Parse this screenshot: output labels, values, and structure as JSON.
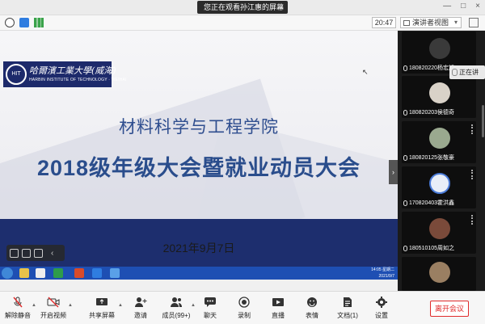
{
  "top_bar": {
    "share_notice": "您正在观看孙江惠的屏幕",
    "close": "×"
  },
  "window_controls": [
    "—",
    "□",
    "×"
  ],
  "status_bar": {
    "time": "20:47",
    "view_button": "演讲者视图",
    "dropdown": "▾"
  },
  "slide": {
    "logo_cn": "哈爾濱工業大學(威海)",
    "logo_en": "HARBIN INSTITUTE OF TECHNOLOGY · WEIHAI",
    "logo_seal": "HIT",
    "college": "材料科学与工程学院",
    "meeting": "2018级年级大会暨就业动员大会",
    "date": "2021年9月7日"
  },
  "taskbar": {
    "clock_line1": "14:05 星期二",
    "clock_line2": "2021/9/7"
  },
  "participants": [
    {
      "name": "180820220杨宏旭",
      "color": "#2a2a2a"
    },
    {
      "name": "180820203侯德奇",
      "color": "#d9d2c8"
    },
    {
      "name": "180820125张敬豪",
      "color": "#8a9a80"
    },
    {
      "name": "170820403霍洪鑫",
      "color": "#4a7bd8"
    },
    {
      "name": "180510105周如之",
      "color": "#7a4a3a"
    },
    {
      "name": "",
      "color": "#9a7f62"
    }
  ],
  "speaking_popup": "正在讲",
  "toolbar": {
    "mute": "解除静音",
    "video": "开启视频",
    "share": "共享屏幕",
    "invite": "邀请",
    "members": "成员(99+)",
    "chat": "聊天",
    "record": "录制",
    "live": "直播",
    "reactions": "表情",
    "docs": "文档(1)",
    "settings": "设置",
    "leave": "离开会议"
  },
  "colors": {
    "slide_title": "#2a4d8c",
    "leave": "#e02b2b",
    "taskbar": "#1e4fb3"
  }
}
